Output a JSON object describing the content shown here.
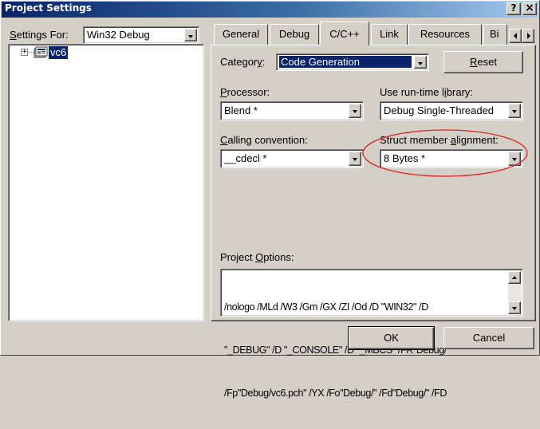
{
  "window": {
    "title": "Project Settings",
    "help_button": "?",
    "close_button": "×"
  },
  "left_pane": {
    "settings_for_label": "Settings For:",
    "settings_for_value": "Win32 Debug",
    "tree_item": "vc6"
  },
  "tabs": [
    {
      "label": "General"
    },
    {
      "label": "Debug"
    },
    {
      "label": "C/C++"
    },
    {
      "label": "Link"
    },
    {
      "label": "Resources"
    },
    {
      "label": "Bi"
    }
  ],
  "active_tab": "C/C++",
  "category": {
    "label": "Category:",
    "value": "Code Generation",
    "reset_button": "Reset"
  },
  "processor": {
    "label": "Processor:",
    "value": "Blend *"
  },
  "runtime_library": {
    "label": "Use run-time library:",
    "value": "Debug Single-Threaded"
  },
  "calling_convention": {
    "label": "Calling convention:",
    "value": "__cdecl *"
  },
  "struct_alignment": {
    "label": "Struct member alignment:",
    "value": "8 Bytes *",
    "highlight_color": "#e02020"
  },
  "project_options": {
    "label": "Project Options:",
    "lines": [
      "/nologo /MLd /W3 /Gm /GX /ZI /Od /D \"WIN32\" /D",
      "\"_DEBUG\" /D \"_CONSOLE\" /D \"_MBCS\" /FR\"Debug/\"",
      "/Fp\"Debug/vc6.pch\" /YX /Fo\"Debug/\" /Fd\"Debug/\" /FD"
    ]
  },
  "footer": {
    "ok_button": "OK",
    "cancel_button": "Cancel"
  },
  "colors": {
    "face": "#d4d0c8",
    "selection": "#0a246a",
    "title_start": "#0a246a",
    "title_end": "#a6caf0"
  }
}
